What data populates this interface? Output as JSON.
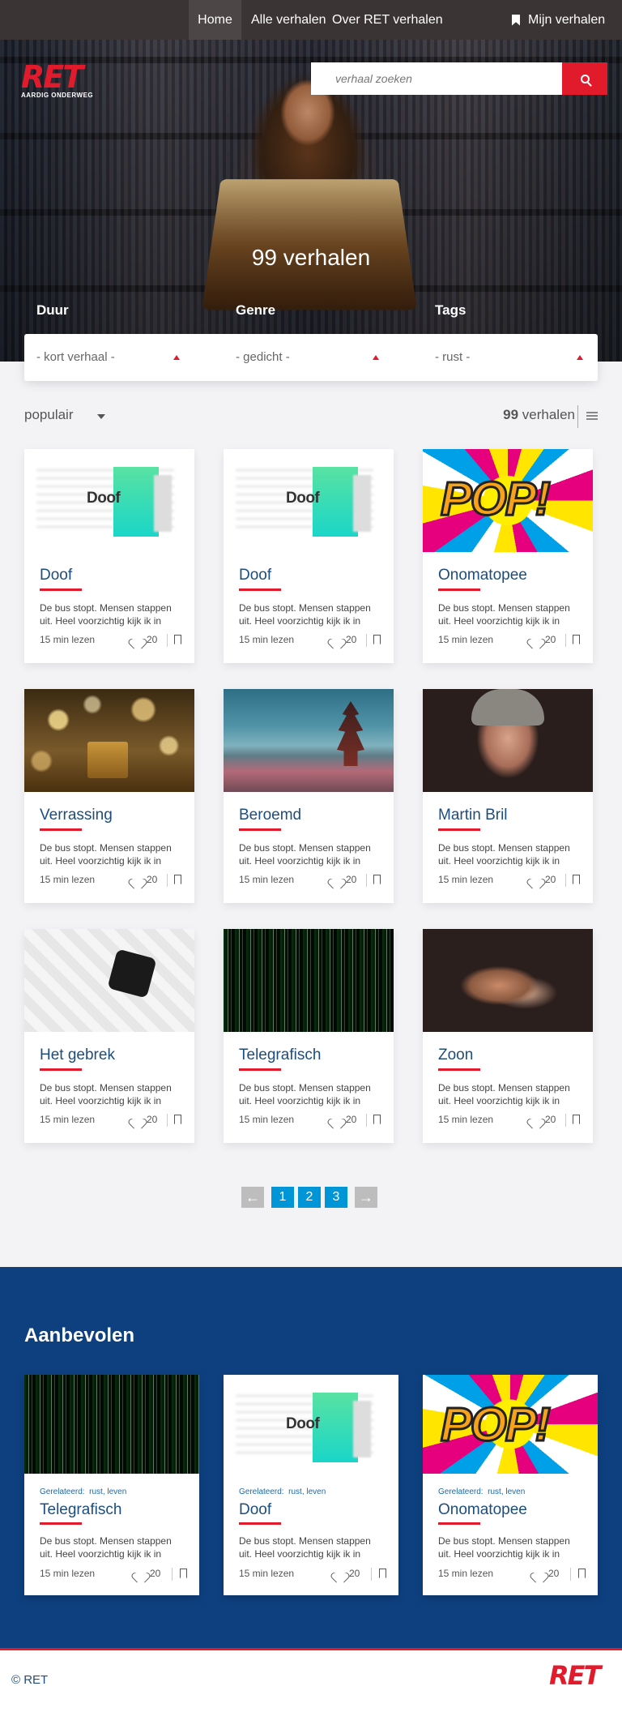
{
  "nav": {
    "items": [
      {
        "label": "Home"
      },
      {
        "label": "Alle verhalen"
      },
      {
        "label": "Over RET verhalen"
      }
    ],
    "my_stories": "Mijn verhalen"
  },
  "logo": {
    "text": "RET",
    "tagline": "AARDIG ONDERWEG"
  },
  "search": {
    "placeholder": "verhaal zoeken",
    "icon": "search-icon"
  },
  "hero": {
    "count": "99 verhalen"
  },
  "filters": [
    {
      "label": "Duur",
      "value": "- kort verhaal -"
    },
    {
      "label": "Genre",
      "value": "- gedicht -"
    },
    {
      "label": "Tags",
      "value": "- rust -"
    }
  ],
  "sort": {
    "value": "populair",
    "count_num": "99",
    "count_word": "verhalen"
  },
  "cards": [
    {
      "title": "Doof",
      "image": "doof",
      "excerpt": "De bus stopt. Mensen stappen uit. Heel voorzichtig kijk ik in",
      "read": "15 min lezen",
      "likes": "20",
      "image_text": "Doof"
    },
    {
      "title": "Doof",
      "image": "doof",
      "excerpt": "De bus stopt. Mensen stappen uit. Heel voorzichtig kijk ik in",
      "read": "15 min lezen",
      "likes": "20",
      "image_text": "Doof"
    },
    {
      "title": "Onomatopee",
      "image": "pop",
      "excerpt": "De bus stopt. Mensen stappen uit. Heel voorzichtig kijk ik in",
      "read": "15 min lezen",
      "likes": "20",
      "image_text": "POP!"
    },
    {
      "title": "Verrassing",
      "image": "gift",
      "excerpt": "De bus stopt. Mensen stappen uit. Heel voorzichtig kijk ik in",
      "read": "15 min lezen",
      "likes": "20"
    },
    {
      "title": "Beroemd",
      "image": "temple",
      "excerpt": "De bus stopt. Mensen stappen uit. Heel voorzichtig kijk ik in",
      "read": "15 min lezen",
      "likes": "20"
    },
    {
      "title": "Martin Bril",
      "image": "face",
      "excerpt": "De bus stopt. Mensen stappen uit. Heel voorzichtig kijk ik in",
      "read": "15 min lezen",
      "likes": "20"
    },
    {
      "title": "Het gebrek",
      "image": "puzzle",
      "excerpt": "De bus stopt. Mensen stappen uit. Heel voorzichtig kijk ik in",
      "read": "15 min lezen",
      "likes": "20"
    },
    {
      "title": "Telegrafisch",
      "image": "matrix",
      "excerpt": "De bus stopt. Mensen stappen uit. Heel voorzichtig kijk ik in",
      "read": "15 min lezen",
      "likes": "20"
    },
    {
      "title": "Zoon",
      "image": "hands",
      "excerpt": "De bus stopt. Mensen stappen uit. Heel voorzichtig kijk ik in",
      "read": "15 min lezen",
      "likes": "20"
    }
  ],
  "pagination": {
    "prev": "←",
    "pages": [
      "1",
      "2",
      "3"
    ],
    "next": "→"
  },
  "recommended": {
    "title": "Aanbevolen",
    "cards": [
      {
        "title": "Telegrafisch",
        "image": "matrix",
        "related_label": "Gerelateerd:",
        "related_tags": "rust, leven",
        "excerpt": "De bus stopt. Mensen stappen uit. Heel voorzichtig kijk ik in",
        "read": "15 min lezen",
        "likes": "20"
      },
      {
        "title": "Doof",
        "image": "doof",
        "related_label": "Gerelateerd:",
        "related_tags": "rust, leven",
        "excerpt": "De bus stopt. Mensen stappen uit. Heel voorzichtig kijk ik in",
        "read": "15 min lezen",
        "likes": "20",
        "image_text": "Doof"
      },
      {
        "title": "Onomatopee",
        "image": "pop",
        "related_label": "Gerelateerd:",
        "related_tags": "rust, leven",
        "excerpt": "De bus stopt. Mensen stappen uit. Heel voorzichtig kijk ik in",
        "read": "15 min lezen",
        "likes": "20",
        "image_text": "POP!"
      }
    ]
  },
  "footer": {
    "copyright": "© RET",
    "logo": "RET"
  },
  "colors": {
    "brand_red": "#e21b2c",
    "navy": "#0e4080",
    "title_blue": "#1d4d7e",
    "page_blue": "#0095d6",
    "nav_bg": "#3a3434"
  }
}
